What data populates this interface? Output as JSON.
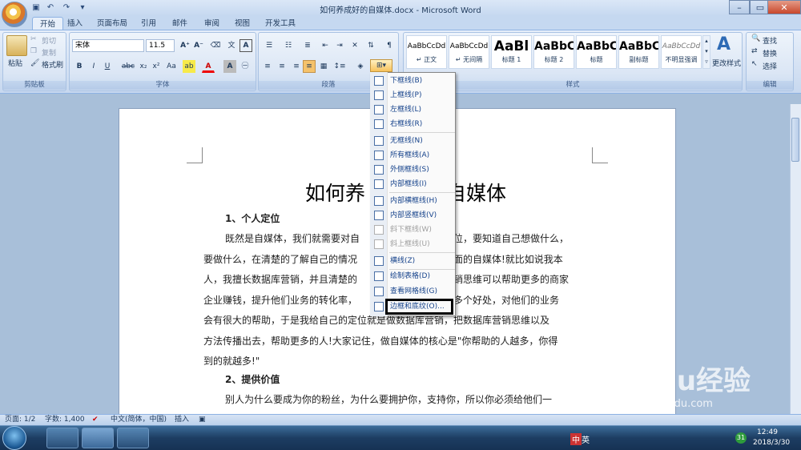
{
  "window": {
    "title": "如何养成好的自媒体.docx - Microsoft Word"
  },
  "tabs": [
    "开始",
    "插入",
    "页面布局",
    "引用",
    "邮件",
    "审阅",
    "视图",
    "开发工具"
  ],
  "clipboard": {
    "paste": "粘贴",
    "cut": "剪切",
    "copy": "复制",
    "format_painter": "格式刷",
    "group": "剪贴板"
  },
  "font": {
    "name": "宋体",
    "size": "11.5",
    "group": "字体"
  },
  "paragraph": {
    "group": "段落"
  },
  "styles": {
    "group": "样式",
    "change_styles": "更改样式",
    "items": [
      {
        "sample": "AaBbCcDd",
        "name": "↵ 正文"
      },
      {
        "sample": "AaBbCcDd",
        "name": "↵ 无间隔"
      },
      {
        "sample": "AaBl",
        "name": "标题 1"
      },
      {
        "sample": "AaBbC",
        "name": "标题 2"
      },
      {
        "sample": "AaBbC",
        "name": "标题"
      },
      {
        "sample": "AaBbC",
        "name": "副标题"
      },
      {
        "sample": "AaBbCcDd",
        "name": "不明显强调"
      }
    ]
  },
  "editing": {
    "group": "编辑",
    "find": "查找",
    "replace": "替换",
    "select": "选择"
  },
  "border_menu": [
    {
      "label": "下框线(B)",
      "disabled": false
    },
    {
      "label": "上框线(P)",
      "disabled": false
    },
    {
      "label": "左框线(L)",
      "disabled": false
    },
    {
      "label": "右框线(R)",
      "disabled": false
    },
    {
      "label": "无框线(N)",
      "disabled": false
    },
    {
      "label": "所有框线(A)",
      "disabled": false
    },
    {
      "label": "外侧框线(S)",
      "disabled": false
    },
    {
      "label": "内部框线(I)",
      "disabled": false
    },
    {
      "label": "内部横框线(H)",
      "disabled": false
    },
    {
      "label": "内部竖框线(V)",
      "disabled": false
    },
    {
      "label": "斜下框线(W)",
      "disabled": true
    },
    {
      "label": "斜上框线(U)",
      "disabled": true
    },
    {
      "label": "横线(Z)",
      "disabled": false
    },
    {
      "label": "绘制表格(D)",
      "disabled": false
    },
    {
      "label": "查看网格线(G)",
      "disabled": false
    },
    {
      "label": "边框和底纹(O)...",
      "disabled": false
    }
  ],
  "document": {
    "title_left": "如何养",
    "title_right": "自媒体",
    "h1": "1、个人定位",
    "lines": [
      "既然是自媒体，我们就需要对自",
      "定位，要知道自己想做什么，",
      "要做什么，在清楚的了解自己的情况",
      "方面的自媒体!就比如说我本",
      "人，我擅长数据库营销，并且清楚的",
      "营销思维可以帮助更多的商家",
      "企业赚钱，提升他们业务的转化率，",
      "等多个好处，对他们的业务",
      "会有很大的帮助，于是我给自己的定位就是做数据库营销，把数据库营销思维以及",
      "方法传播出去，帮助更多的人!大家记住，做自媒体的核心是\"你帮助的人越多，你得",
      "到的就越多!\""
    ],
    "h2": "2、提供价值",
    "last_line": "别人为什么要成为你的粉丝，为什么要拥护你，支持你，所以你必须给他们一"
  },
  "status": {
    "page": "页面: 1/2",
    "words": "字数: 1,400",
    "lang": "中文(简体，中国)",
    "insert": "插入"
  },
  "tray": {
    "lang": "英",
    "time": "12:49",
    "date": "2018/3/30",
    "badge": "31"
  },
  "watermark": {
    "main": "Baidu经验",
    "sub": "jingyan.baidu.com"
  }
}
